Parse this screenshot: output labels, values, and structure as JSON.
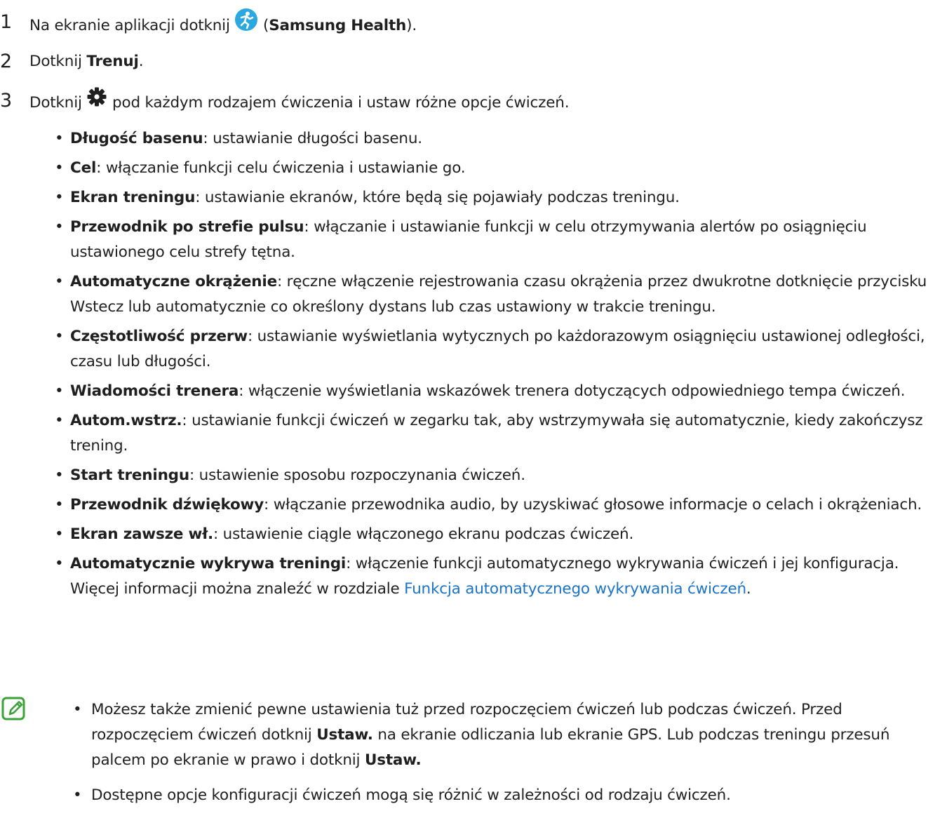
{
  "steps": [
    {
      "num": "1",
      "text_before": "Na ekranie aplikacji dotknij",
      "text_mid": "(",
      "bold": "Samsung Health",
      "text_after": ")."
    },
    {
      "num": "2",
      "text_before": "Dotknij",
      "bold": "Trenuj",
      "text_after": "."
    },
    {
      "num": "3",
      "text_before": "Dotknij",
      "text_after": "pod każdym rodzajem ćwiczenia i ustaw różne opcje ćwiczeń."
    }
  ],
  "icons": {
    "app_icon": "samsung-health-icon",
    "settings_icon": "gear-icon",
    "note_icon": "note-pencil-icon"
  },
  "options": [
    {
      "term": "Długość basenu",
      "desc": ": ustawianie długości basenu."
    },
    {
      "term": "Cel",
      "desc": ": włączanie funkcji celu ćwiczenia i ustawianie go."
    },
    {
      "term": "Ekran treningu",
      "desc": ": ustawianie ekranów, które będą się pojawiały podczas treningu."
    },
    {
      "term": "Przewodnik po strefie pulsu",
      "desc": ": włączanie i ustawianie funkcji w celu otrzymywania alertów po osiągnięciu ustawionego celu strefy tętna."
    },
    {
      "term": "Automatyczne okrążenie",
      "desc": ": ręczne włączenie rejestrowania czasu okrążenia przez dwukrotne dotknięcie przycisku Wstecz lub automatycznie co określony dystans lub czas ustawiony w trakcie treningu."
    },
    {
      "term": "Częstotliwość przerw",
      "desc": ": ustawianie wyświetlania wytycznych po każdorazowym osiągnięciu ustawionej odległości, czasu lub długości."
    },
    {
      "term": "Wiadomości trenera",
      "desc": ": włączenie wyświetlania wskazówek trenera dotyczących odpowiedniego tempa ćwiczeń."
    },
    {
      "term": "Autom.wstrz.",
      "desc": ": ustawianie funkcji ćwiczeń w zegarku tak, aby wstrzymywała się automatycznie, kiedy zakończysz trening."
    },
    {
      "term": "Start treningu",
      "desc": ": ustawienie sposobu rozpoczynania ćwiczeń."
    },
    {
      "term": "Przewodnik dźwiękowy",
      "desc": ": włączanie przewodnika audio, by uzyskiwać głosowe informacje o celach i okrążeniach."
    },
    {
      "term": "Ekran zawsze wł.",
      "desc": ": ustawienie ciągle włączonego ekranu podczas ćwiczeń."
    },
    {
      "term": "Automatycznie wykrywa treningi",
      "desc": ": włączenie funkcji automatycznego wykrywania ćwiczeń i jej konfiguracja. Więcej informacji można znaleźć w rozdziale ",
      "link": "Funkcja automatycznego wykrywania ćwiczeń",
      "end": "."
    }
  ],
  "note": {
    "item1_a": "Możesz także zmienić pewne ustawienia tuż przed rozpoczęciem ćwiczeń lub podczas ćwiczeń. Przed rozpoczęciem ćwiczeń dotknij ",
    "item1_b1": "Ustaw.",
    "item1_c": " na ekranie odliczania lub ekranie GPS. Lub podczas treningu przesuń palcem po ekranie w prawo i dotknij ",
    "item1_b2": "Ustaw.",
    "item2": "Dostępne opcje konfiguracji ćwiczeń mogą się różnić w zależności od rodzaju ćwiczeń."
  },
  "colors": {
    "link": "#1a73c8",
    "note_icon": "#3aa236",
    "app_icon_bg": "#2aa8e0",
    "app_icon_fg": "#ffffff"
  }
}
